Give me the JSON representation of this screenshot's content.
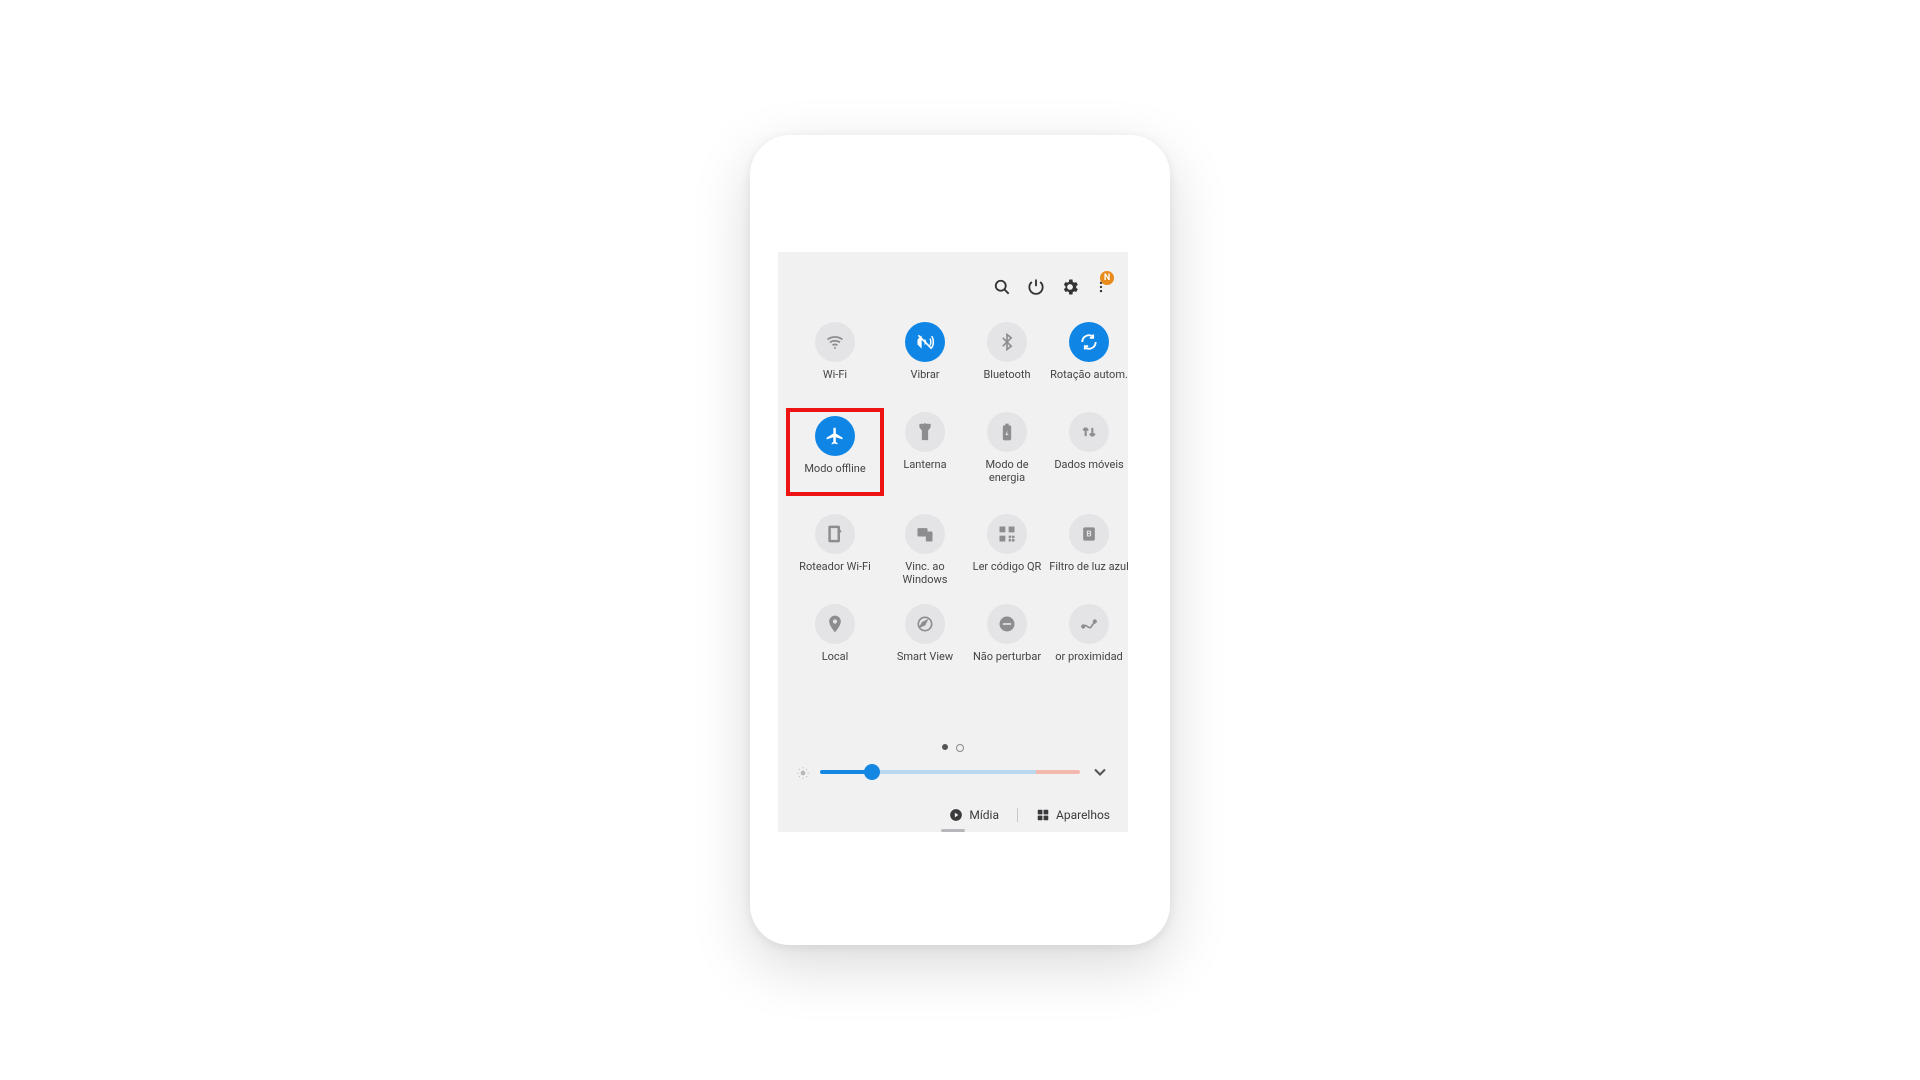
{
  "topbar": {
    "badge": "N"
  },
  "tiles": [
    {
      "label": "Wi-Fi",
      "icon": "wifi",
      "active": false
    },
    {
      "label": "Vibrar",
      "icon": "vibrate",
      "active": true
    },
    {
      "label": "Bluetooth",
      "icon": "bluetooth",
      "active": false
    },
    {
      "label": "Rotação autom.",
      "icon": "rotate",
      "active": true
    },
    {
      "label": "Modo offline",
      "icon": "airplane",
      "active": true,
      "highlight": true
    },
    {
      "label": "Lanterna",
      "icon": "flashlight",
      "active": false
    },
    {
      "label": "Modo de energia",
      "icon": "power-save",
      "active": false
    },
    {
      "label": "Dados móveis",
      "icon": "data",
      "active": false
    },
    {
      "label": "Roteador Wi-Fi",
      "icon": "hotspot",
      "active": false
    },
    {
      "label": "Vinc. ao Windows",
      "icon": "link-windows",
      "active": false
    },
    {
      "label": "Ler código QR",
      "icon": "qr",
      "active": false
    },
    {
      "label": "Filtro de luz azul",
      "icon": "blue-light",
      "active": false
    },
    {
      "label": "Local",
      "icon": "location",
      "active": false
    },
    {
      "label": "Smart View",
      "icon": "smart-view",
      "active": false
    },
    {
      "label": "Não perturbar",
      "icon": "dnd",
      "active": false
    },
    {
      "label": "or proximidad",
      "icon": "nearby",
      "active": false
    }
  ],
  "pager": {
    "total": 2,
    "active": 0
  },
  "brightness": {
    "percent": 20
  },
  "footer": {
    "media": "Mídia",
    "devices": "Aparelhos"
  }
}
